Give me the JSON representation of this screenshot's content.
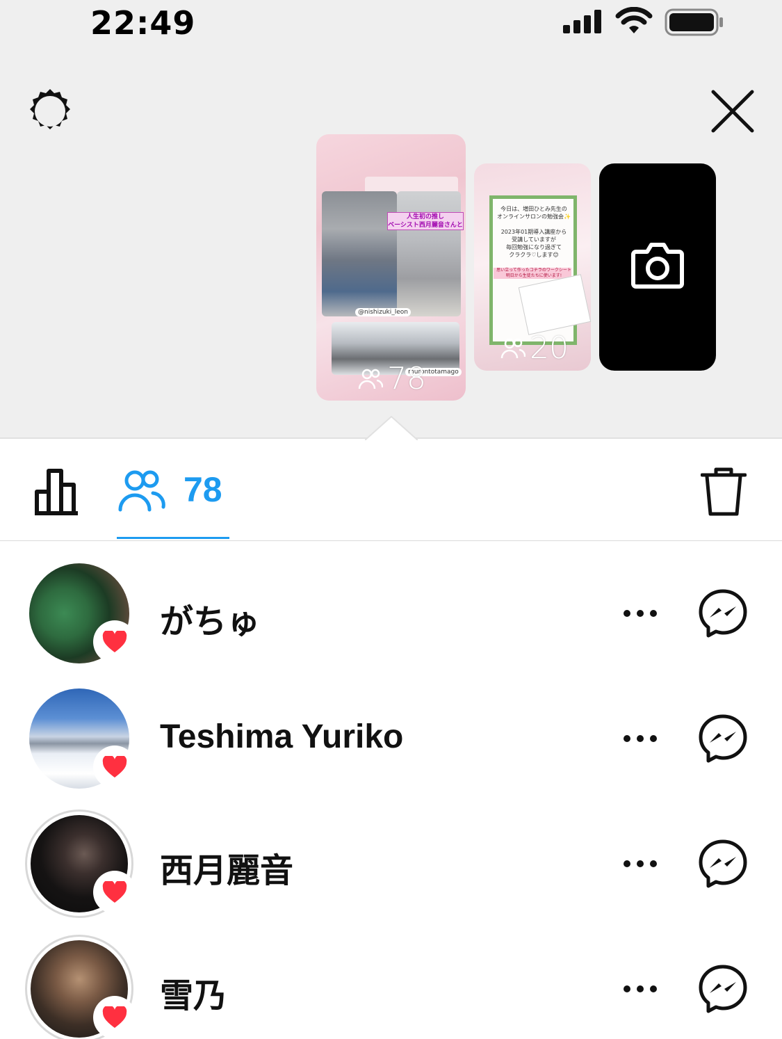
{
  "status_bar": {
    "time": "22:49",
    "signal_icon": "cellular-signal-icon",
    "wifi_icon": "wifi-icon",
    "battery_icon": "battery-icon"
  },
  "header": {
    "settings_icon": "gear-icon",
    "close_icon": "close-icon"
  },
  "stories": [
    {
      "viewers": "78",
      "banner_caption": "人生初の推し\nベーシスト西月麗音さんと",
      "handle_1": "@nishizuki_leon",
      "handle_2": "murontotamago"
    },
    {
      "viewers": "20",
      "text": "今日は、増田ひとみ先生の\nオンラインサロンの勉強会✨\n\n2023年01期導入講座から\n受講していますが\n毎回勉強になり過ぎて\nクラクラ♡します😊",
      "pink_text": "思い立って作ったコチラのワークシート\n明日から生徒たちに使います!"
    },
    {
      "type": "camera",
      "icon": "camera-icon"
    }
  ],
  "tabs": {
    "insights_icon": "bar-chart-icon",
    "viewers_icon": "people-icon",
    "viewers_count": "78",
    "delete_icon": "trash-icon"
  },
  "viewers": [
    {
      "name": "がちゅ",
      "liked": true
    },
    {
      "name": "Teshima Yuriko",
      "liked": true
    },
    {
      "name": "西月麗音",
      "liked": true
    },
    {
      "name": "雪乃",
      "liked": true
    }
  ],
  "colors": {
    "accent": "#1d9bf0",
    "heart": "#ff3040",
    "top_background": "#efefef"
  }
}
